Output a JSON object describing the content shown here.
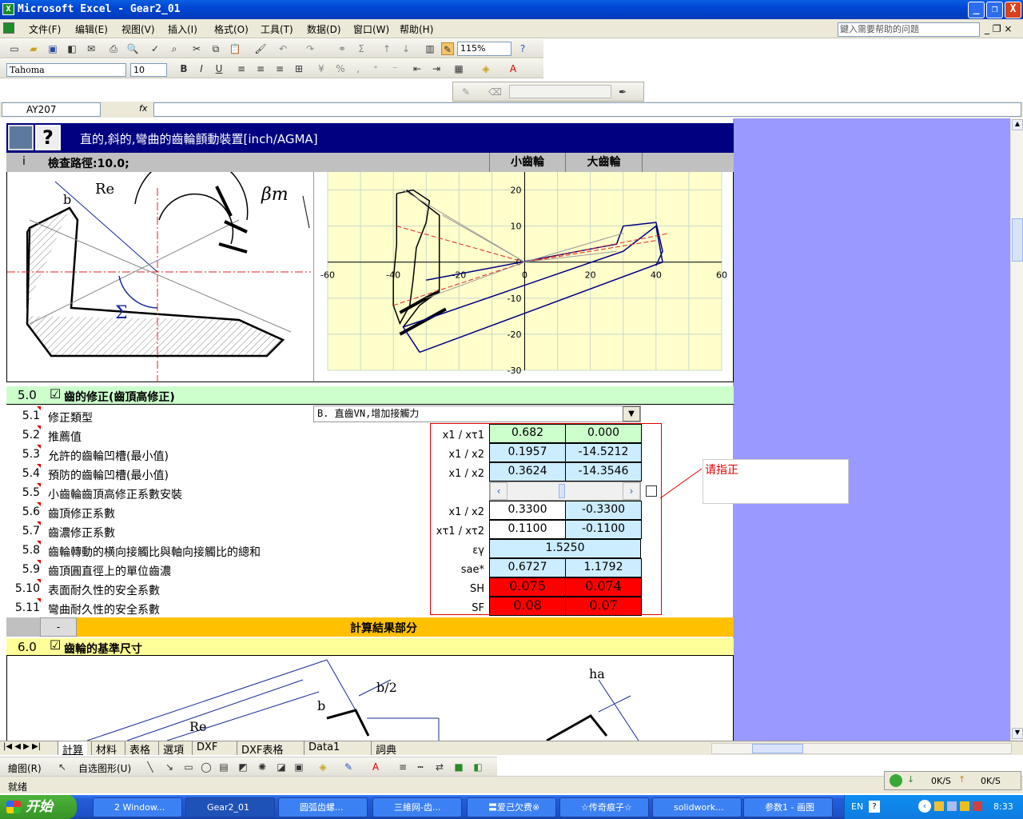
{
  "window": {
    "title": "Microsoft Excel - Gear2_01",
    "min": "_",
    "max": "❐",
    "close": "X"
  },
  "menu": [
    "文件(F)",
    "编辑(E)",
    "视图(V)",
    "插入(I)",
    "格式(O)",
    "工具(T)",
    "数据(D)",
    "窗口(W)",
    "帮助(H)"
  ],
  "help_placeholder": "鍵入需要帮助的问题",
  "toolbar": {
    "zoom": "115%",
    "font": "Tahoma",
    "size": "10"
  },
  "formula": {
    "cell_ref": "AY207",
    "fx": "fx"
  },
  "sheet": {
    "header_title": "直的,斜的,彎曲的齒輪顫動裝置[inch/AGMA]",
    "info_label": "i",
    "check_path": "檢查路徑:10.0;",
    "col_small": "小齒輪",
    "col_large": "大齒輪",
    "drawing_labels": {
      "re": "Re",
      "b": "b",
      "beta": "βm",
      "sigma": "Σ"
    },
    "section5": {
      "num": "5.0",
      "title": "齒的修正(齒頂高修正)",
      "checked": "☑"
    },
    "dropdown_value": "B. 直齒VN,增加接觸力",
    "rows": [
      {
        "num": "5.1",
        "label": "修正類型",
        "sym": "",
        "v1": "",
        "v2": ""
      },
      {
        "num": "5.2",
        "label": "推薦值",
        "sym": "x1 / xτ1",
        "v1": "0.682",
        "v2": "0.000"
      },
      {
        "num": "5.3",
        "label": "允許的齒輪凹槽(最小值)",
        "sym": "x1 / x2",
        "v1": "0.1957",
        "v2": "-14.5212"
      },
      {
        "num": "5.4",
        "label": "預防的齒輪凹槽(最小值)",
        "sym": "x1 / x2",
        "v1": "0.3624",
        "v2": "-14.3546"
      },
      {
        "num": "5.5",
        "label": "小齒輪齒頂高修正系數安裝",
        "sym": "",
        "v1": "",
        "v2": ""
      },
      {
        "num": "5.6",
        "label": "齒頂修正系數",
        "sym": "x1 / x2",
        "v1": "0.3300",
        "v2": "-0.3300"
      },
      {
        "num": "5.7",
        "label": "齒濃修正系數",
        "sym": "xτ1 / xτ2",
        "v1": "0.1100",
        "v2": "-0.1100"
      },
      {
        "num": "5.8",
        "label": "齒輪轉動的横向接觸比與軸向接觸比的總和",
        "sym": "εγ",
        "v1": "1.5250",
        "v2": ""
      },
      {
        "num": "5.9",
        "label": "齒頂圓直徑上的單位齒濃",
        "sym": "sae*",
        "v1": "0.6727",
        "v2": "1.1792"
      },
      {
        "num": "5.10",
        "label": "表面耐久性的安全系數",
        "sym": "SH",
        "v1": "0.075",
        "v2": "0.074"
      },
      {
        "num": "5.11",
        "label": "彎曲耐久性的安全系數",
        "sym": "SF",
        "v1": "0.08",
        "v2": "0.07"
      }
    ],
    "comment": "请指正",
    "results_dash": "-",
    "results_title": "計算結果部分",
    "section6": {
      "num": "6.0",
      "title": "齒輪的基準尺寸",
      "checked": "☑"
    },
    "bottom_labels": {
      "b2": "b/2",
      "b": "b",
      "re": "Re",
      "ha": "ha"
    }
  },
  "chart_data": {
    "type": "scatter",
    "xlim": [
      -60,
      60
    ],
    "ylim": [
      -30,
      25
    ],
    "xticks": [
      "-60",
      "-40",
      "-20",
      "0",
      "20",
      "40",
      "60"
    ],
    "yticks": [
      "20",
      "10",
      "0",
      "-10",
      "-20",
      "-30"
    ],
    "grid": true
  },
  "tabs": [
    "計算",
    "材料",
    "表格",
    "選項",
    "DXF",
    "DXF表格",
    "Data1",
    "詞典"
  ],
  "drawbar": {
    "draw": "繪图(R)",
    "autoshape": "自选图形(U)"
  },
  "status": "就绪",
  "taskbar": {
    "start": "开始",
    "items": [
      "2 Window...",
      "Gear2_01",
      "圆弧齿螺...",
      "三維网-齿...",
      "〓爱己欠费※",
      "☆传奇痕子☆",
      "solidwork...",
      "参数1 - 画图"
    ],
    "tray_lang": "EN",
    "clock": "8:33",
    "net1": "0K/S",
    "net2": "0K/S"
  }
}
